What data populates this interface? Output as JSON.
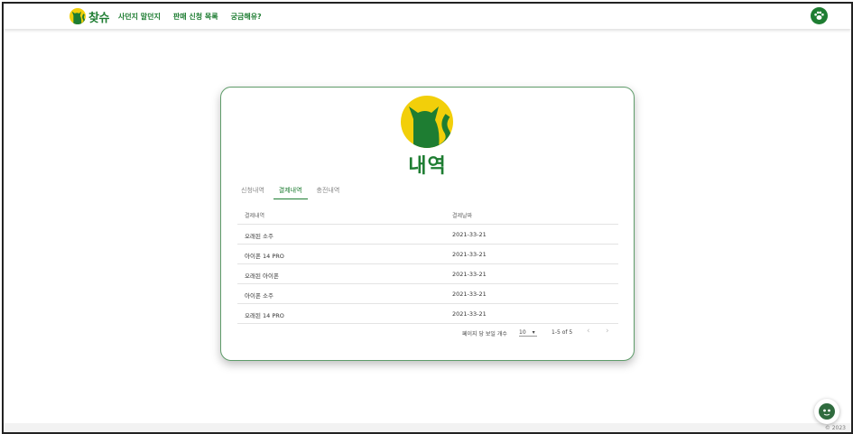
{
  "colors": {
    "brand_green": "#1e7d32",
    "brand_yellow": "#f2cf0a",
    "card_border": "#5f9c6a"
  },
  "nav": {
    "brand": "찾슈",
    "links": [
      "사던지 말던지",
      "판매 신청 목록",
      "궁금해유?"
    ],
    "profile_icon": "paw-icon"
  },
  "page": {
    "title": "내역",
    "tabs": [
      "신청내역",
      "결제내역",
      "충전내역"
    ],
    "active_tab": "결제내역"
  },
  "table": {
    "headers": [
      "결제내역",
      "결제날짜"
    ],
    "rows": [
      [
        "오래된 소주",
        "2021-33-21"
      ],
      [
        "아이폰 14 PRO",
        "2021-33-21"
      ],
      [
        "오래된 아이폰",
        "2021-33-21"
      ],
      [
        "아이폰 소주",
        "2021-33-21"
      ],
      [
        "오래된 14 PRO",
        "2021-33-21"
      ]
    ]
  },
  "pagination": {
    "rows_per_page_label": "페이지 당 보일 개수",
    "rows_per_page_value": "10",
    "range_text": "1-5 of 5",
    "prev_icon": "chevron-left-icon",
    "next_icon": "chevron-right-icon"
  },
  "footer": {
    "copyright": "© 2023"
  },
  "chat_icon": "chat-bot-icon"
}
